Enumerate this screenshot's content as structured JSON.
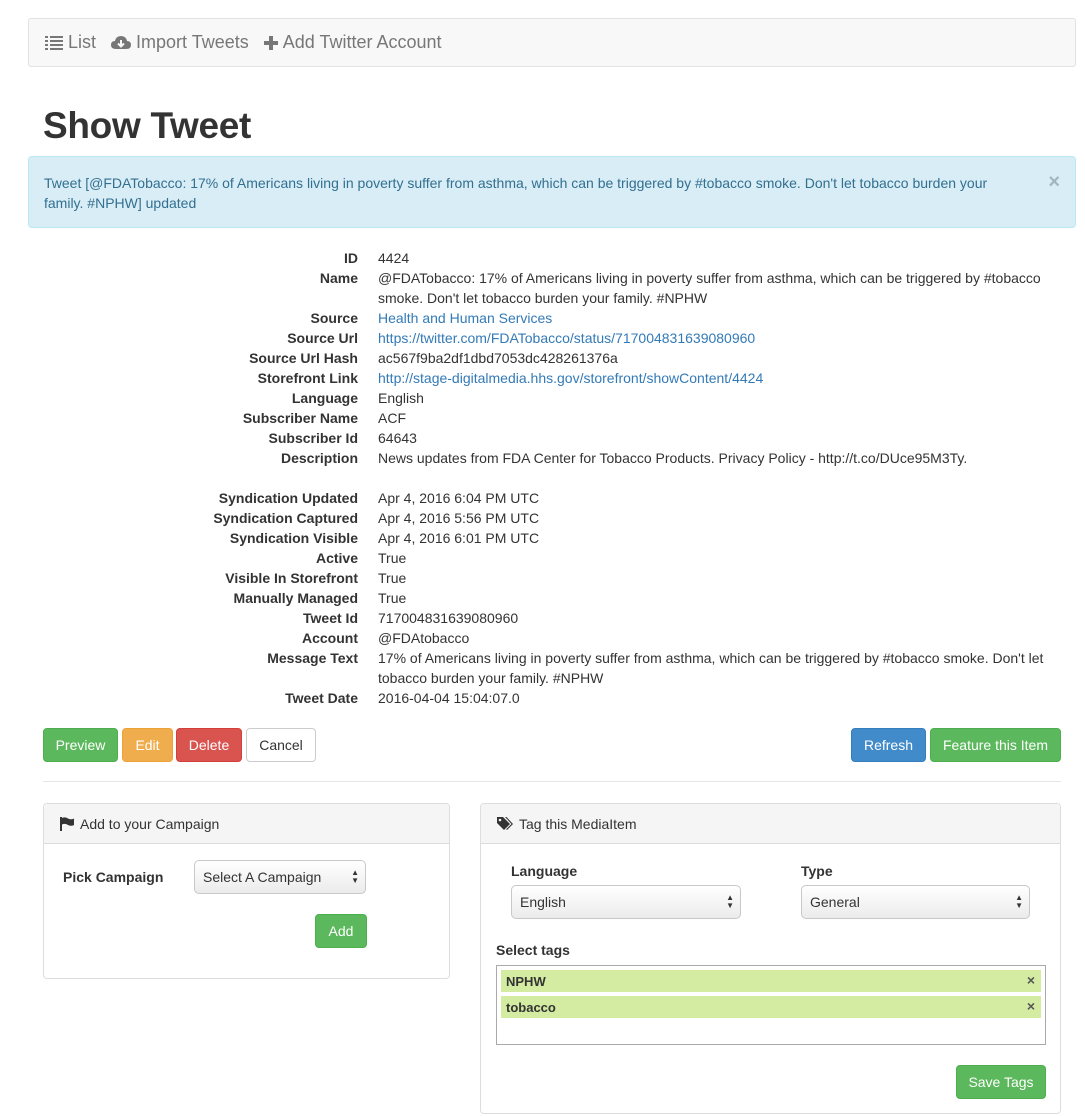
{
  "nav": {
    "list": "List",
    "import": "Import Tweets",
    "add_account": "Add Twitter Account"
  },
  "page_title": "Show Tweet",
  "alert": {
    "message": "Tweet [@FDATobacco: 17% of Americans living in poverty suffer from asthma, which can be triggered by #tobacco smoke. Don't let tobacco burden your family. #NPHW] updated",
    "close": "×"
  },
  "details": {
    "id": {
      "label": "ID",
      "value": "4424"
    },
    "name": {
      "label": "Name",
      "value": "@FDATobacco: 17% of Americans living in poverty suffer from asthma, which can be triggered by #tobacco smoke. Don't let tobacco burden your family. #NPHW"
    },
    "source": {
      "label": "Source",
      "value": "Health and Human Services"
    },
    "source_url": {
      "label": "Source Url",
      "value": "https://twitter.com/FDATobacco/status/717004831639080960"
    },
    "source_url_hash": {
      "label": "Source Url Hash",
      "value": "ac567f9ba2df1dbd7053dc428261376a"
    },
    "storefront_link": {
      "label": "Storefront Link",
      "value": "http://stage-digitalmedia.hhs.gov/storefront/showContent/4424"
    },
    "language": {
      "label": "Language",
      "value": "English"
    },
    "subscriber_name": {
      "label": "Subscriber Name",
      "value": "ACF"
    },
    "subscriber_id": {
      "label": "Subscriber Id",
      "value": "64643"
    },
    "description": {
      "label": "Description",
      "value": "News updates from FDA Center for Tobacco Products. Privacy Policy - http://t.co/DUce95M3Ty."
    },
    "syndication_updated": {
      "label": "Syndication Updated",
      "value": "Apr 4, 2016 6:04 PM UTC"
    },
    "syndication_captured": {
      "label": "Syndication Captured",
      "value": "Apr 4, 2016 5:56 PM UTC"
    },
    "syndication_visible": {
      "label": "Syndication Visible",
      "value": "Apr 4, 2016 6:01 PM UTC"
    },
    "active": {
      "label": "Active",
      "value": "True"
    },
    "visible_in_storefront": {
      "label": "Visible In Storefront",
      "value": "True"
    },
    "manually_managed": {
      "label": "Manually Managed",
      "value": "True"
    },
    "tweet_id": {
      "label": "Tweet Id",
      "value": "717004831639080960"
    },
    "account": {
      "label": "Account",
      "value": "@FDAtobacco"
    },
    "message_text": {
      "label": "Message Text",
      "value": "17% of Americans living in poverty suffer from asthma, which can be triggered by #tobacco smoke. Don't let tobacco burden your family. #NPHW"
    },
    "tweet_date": {
      "label": "Tweet Date",
      "value": "2016-04-04 15:04:07.0"
    }
  },
  "actions": {
    "preview": "Preview",
    "edit": "Edit",
    "delete": "Delete",
    "cancel": "Cancel",
    "refresh": "Refresh",
    "feature": "Feature this Item"
  },
  "campaign_panel": {
    "heading": "Add to your Campaign",
    "pick_label": "Pick Campaign",
    "select_value": "Select A Campaign",
    "add_button": "Add"
  },
  "tag_panel": {
    "heading": "Tag this MediaItem",
    "language_label": "Language",
    "language_value": "English",
    "type_label": "Type",
    "type_value": "General",
    "select_tags_label": "Select tags",
    "tags": [
      "NPHW",
      "tobacco"
    ],
    "save_button": "Save Tags"
  },
  "colors": {
    "success": "#5cb85c",
    "warning": "#f0ad4e",
    "danger": "#d9534f",
    "primary": "#428bca",
    "link": "#337ab7",
    "alert_bg": "#d9edf7",
    "tag_bg": "#d4eba2"
  }
}
